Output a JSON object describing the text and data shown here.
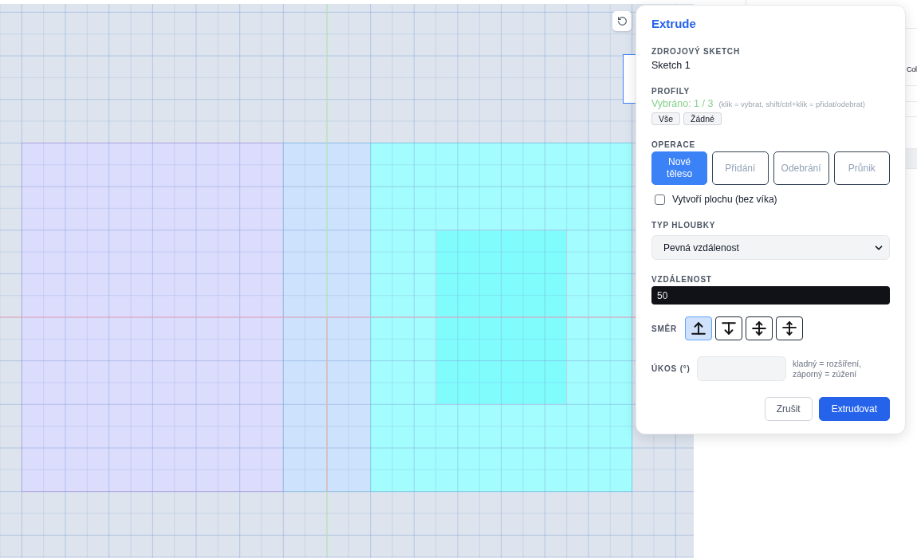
{
  "side_panel": {
    "column_header": "Col"
  },
  "dialog": {
    "title": "Extrude",
    "source_sketch": {
      "label": "ZDROJOVÝ SKETCH",
      "value": "Sketch 1"
    },
    "profiles": {
      "label": "PROFILY",
      "selection": "Vybráno: 1 / 3",
      "hint": "(klik = vybrat, shift/ctrl+klik = přidat/odebrat)",
      "buttons": [
        "Vše",
        "Žádné"
      ]
    },
    "operation": {
      "label": "OPERACE",
      "options": [
        {
          "label": "Nové těleso",
          "selected": true
        },
        {
          "label": "Přidání",
          "selected": false
        },
        {
          "label": "Odebrání",
          "selected": false
        },
        {
          "label": "Průnik",
          "selected": false
        }
      ]
    },
    "surface_option": {
      "label": "Vytvoří plochu (bez víka)",
      "checked": false
    },
    "depth_type": {
      "label": "TYP HLOUBKY",
      "value": "Pevná vzdálenost"
    },
    "distance": {
      "label": "VZDÁLENOST",
      "value": "50"
    },
    "direction": {
      "label": "SMĚR",
      "options": [
        {
          "kind": "up",
          "selected": true
        },
        {
          "kind": "down",
          "selected": false
        },
        {
          "kind": "symmetric",
          "selected": false
        },
        {
          "kind": "two_sided",
          "selected": false
        }
      ]
    },
    "taper": {
      "label": "ÚKOS (°)",
      "hint": "kladný = rozšíření, záporný = zúžení"
    },
    "buttons": [
      {
        "label": "Zrušit",
        "kind": "secondary"
      },
      {
        "label": "Extrudovat",
        "kind": "primary"
      }
    ]
  }
}
